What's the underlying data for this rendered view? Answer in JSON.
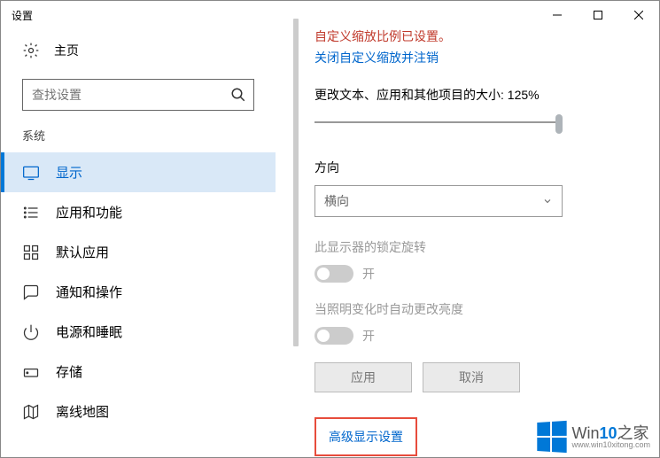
{
  "window": {
    "title": "设置"
  },
  "home": {
    "label": "主页"
  },
  "search": {
    "placeholder": "查找设置"
  },
  "category": "系统",
  "nav": [
    {
      "label": "显示"
    },
    {
      "label": "应用和功能"
    },
    {
      "label": "默认应用"
    },
    {
      "label": "通知和操作"
    },
    {
      "label": "电源和睡眠"
    },
    {
      "label": "存储"
    },
    {
      "label": "离线地图"
    }
  ],
  "main": {
    "custom_scale_warn": "自定义缩放比例已设置。",
    "turn_off_link": "关闭自定义缩放并注销",
    "scale_label": "更改文本、应用和其他项目的大小: 125%",
    "orientation_label": "方向",
    "orientation_value": "横向",
    "lock_rotation_label": "此显示器的锁定旋转",
    "brightness_label": "当照明变化时自动更改亮度",
    "toggle_on": "开",
    "apply": "应用",
    "cancel": "取消",
    "advanced": "高级显示设置"
  },
  "watermark": {
    "brand_a": "Win",
    "brand_b": "10",
    "brand_c": "之家",
    "url": "www.win10xitong.com"
  }
}
